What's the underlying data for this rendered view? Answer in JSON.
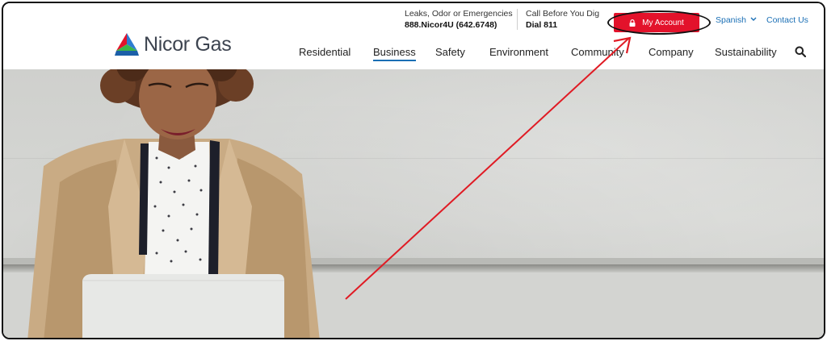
{
  "brand": {
    "name": "Nicor Gas"
  },
  "utility": {
    "emergency_label": "Leaks, Odor or Emergencies",
    "emergency_phone": "888.Nicor4U (642.6748)",
    "dig_label": "Call Before You Dig",
    "dig_phone": "Dial 811"
  },
  "actions": {
    "my_account": "My Account",
    "language": "Spanish",
    "contact": "Contact Us"
  },
  "nav": {
    "items": [
      "Residential",
      "Business",
      "Safety",
      "Environment",
      "Community",
      "Company",
      "Sustainability"
    ],
    "active": "Business"
  },
  "icons": [
    "lock-icon",
    "chevron-down-icon",
    "search-icon",
    "logo-triangle-icon"
  ],
  "colors": {
    "accent_red": "#e3122b",
    "link_blue": "#1a6fb5",
    "annotation": "#e01b24"
  }
}
